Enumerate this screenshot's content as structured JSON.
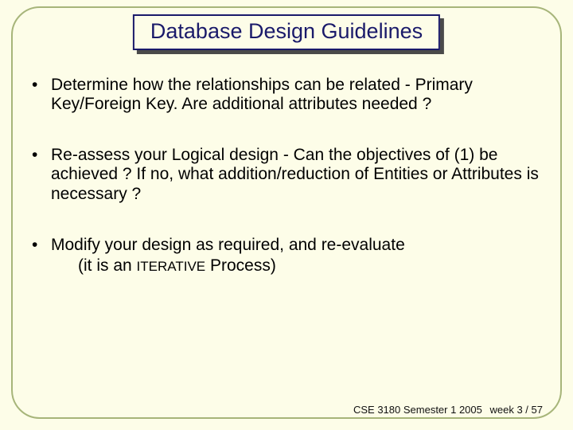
{
  "title": "Database Design Guidelines",
  "bullets": [
    "Determine how the relationships can be related - Primary Key/Foreign Key. Are additional attributes needed ?",
    "Re-assess your Logical design -  Can the objectives of (1) be achieved ?  If no, what addition/reduction of Entities or Attributes is necessary ?"
  ],
  "bullet3": {
    "line1": "Modify your design as required, and re-evaluate",
    "line2_pre": "(it is an ",
    "line2_caps": "ITERATIVE",
    "line2_post": " Process)"
  },
  "footer": {
    "course": "CSE 3180 Semester 1 2005",
    "week": "week 3 / ",
    "page": "57"
  }
}
